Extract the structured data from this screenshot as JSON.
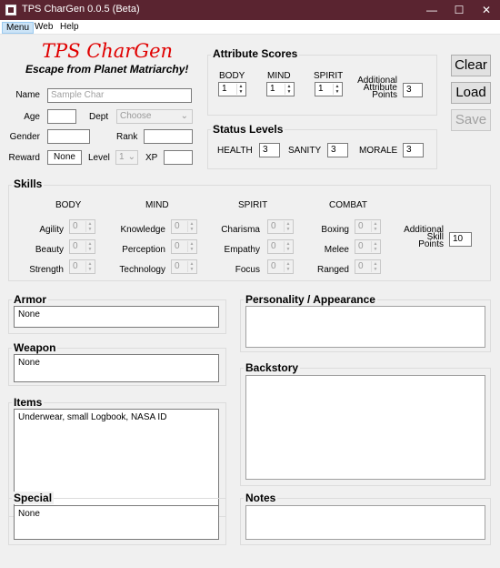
{
  "window": {
    "title": "TPS CharGen 0.0.5 (Beta)",
    "minimize": "—",
    "maximize": "☐",
    "close": "✕"
  },
  "menu": {
    "items": [
      "Menu",
      "Web",
      "Help"
    ]
  },
  "header": {
    "title": "TPS CharGen",
    "subtitle": "Escape from Planet Matriarchy!"
  },
  "colors": {
    "title_red": "#e00000",
    "titlebar": "#5a2430"
  },
  "char": {
    "name_label": "Name",
    "name_placeholder": "Sample Char",
    "age_label": "Age",
    "age_value": "",
    "dept_label": "Dept",
    "dept_value": "Choose",
    "gender_label": "Gender",
    "gender_value": "",
    "rank_label": "Rank",
    "rank_value": "",
    "reward_label": "Reward",
    "reward_value": "None",
    "level_label": "Level",
    "level_value": "1",
    "xp_label": "XP",
    "xp_value": ""
  },
  "attributes": {
    "title": "Attribute Scores",
    "body_label": "BODY",
    "body_value": "1",
    "mind_label": "MIND",
    "mind_value": "1",
    "spirit_label": "SPIRIT",
    "spirit_value": "1",
    "additional_line1": "Additional",
    "additional_line2": "Attribute",
    "additional_line3": "Points",
    "additional_value": "3"
  },
  "status": {
    "title": "Status Levels",
    "health_label": "HEALTH",
    "health_value": "3",
    "sanity_label": "SANITY",
    "sanity_value": "3",
    "morale_label": "MORALE",
    "morale_value": "3"
  },
  "buttons": {
    "clear": "Clear",
    "load": "Load",
    "save": "Save"
  },
  "skills": {
    "title": "Skills",
    "body_header": "BODY",
    "mind_header": "MIND",
    "spirit_header": "SPIRIT",
    "combat_header": "COMBAT",
    "agility": "Agility",
    "beauty": "Beauty",
    "strength": "Strength",
    "knowledge": "Knowledge",
    "perception": "Perception",
    "technology": "Technology",
    "charisma": "Charisma",
    "empathy": "Empathy",
    "focus": "Focus",
    "boxing": "Boxing",
    "melee": "Melee",
    "ranged": "Ranged",
    "zero": "0",
    "additional_line1": "Additional",
    "additional_line2": "Skill",
    "additional_line3": "Points",
    "additional_value": "10"
  },
  "armor": {
    "title": "Armor",
    "value": "None"
  },
  "weapon": {
    "title": "Weapon",
    "value": "None"
  },
  "items": {
    "title": "Items",
    "value": "Underwear, small Logbook, NASA ID"
  },
  "special": {
    "title": "Special",
    "value": "None"
  },
  "personality": {
    "title": "Personality / Appearance",
    "value": ""
  },
  "backstory": {
    "title": "Backstory",
    "value": ""
  },
  "notes": {
    "title": "Notes",
    "value": ""
  }
}
